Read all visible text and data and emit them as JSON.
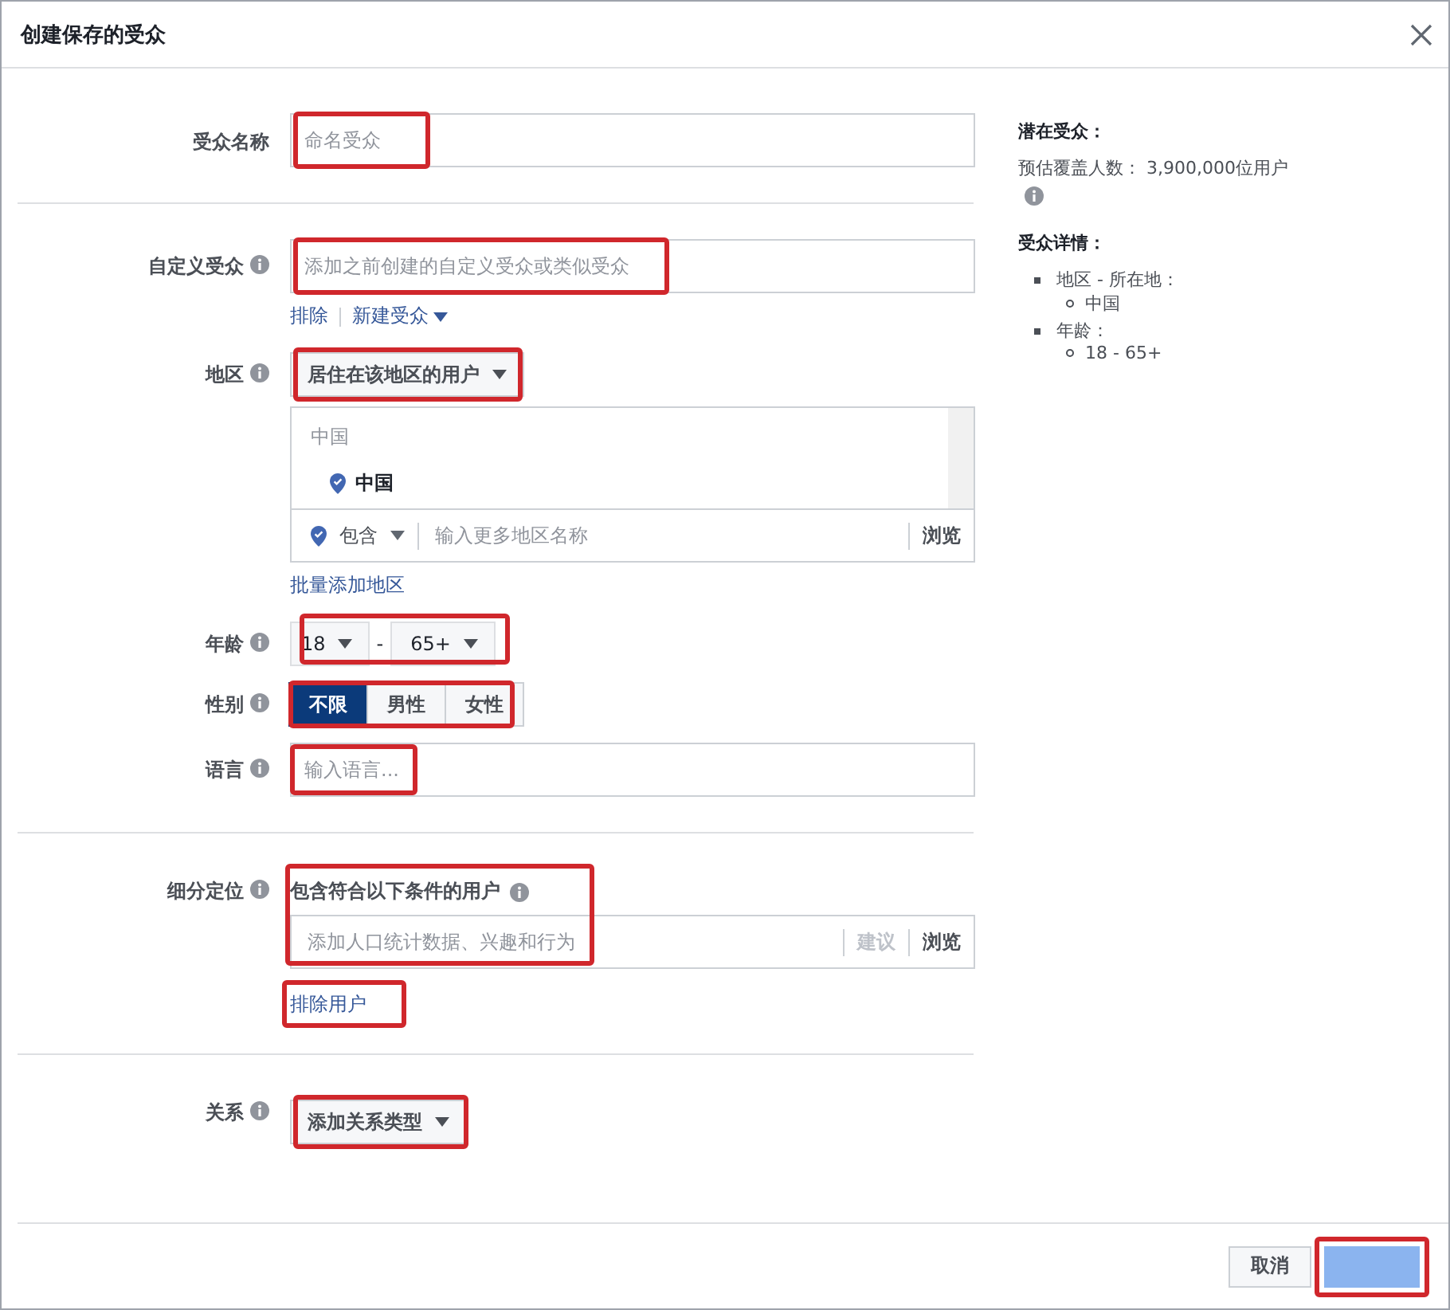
{
  "dialog": {
    "title": "创建保存的受众"
  },
  "audience_name": {
    "label": "受众名称",
    "placeholder": "命名受众",
    "highlighted": true
  },
  "custom_audience": {
    "label": "自定义受众",
    "placeholder": "添加之前创建的自定义受众或类似受众",
    "highlighted": true,
    "links": [
      {
        "label": "排除",
        "dropdown": false
      },
      {
        "label": "新建受众",
        "dropdown": true
      }
    ]
  },
  "location": {
    "label": "地区",
    "mode": "居住在该地区的用户",
    "highlighted": true,
    "group": "中国",
    "items": [
      {
        "label": "中国"
      }
    ],
    "include": "包含",
    "placeholder": "输入更多地区名称",
    "browse": "浏览",
    "bulk_link": "批量添加地区"
  },
  "age": {
    "label": "年龄",
    "min": "18",
    "separator": "-",
    "max": "65+",
    "highlighted": true
  },
  "gender": {
    "label": "性别",
    "highlighted": true,
    "options": [
      {
        "label": "不限",
        "selected": true
      },
      {
        "label": "男性",
        "selected": false
      },
      {
        "label": "女性",
        "selected": false
      }
    ]
  },
  "language": {
    "label": "语言",
    "placeholder": "输入语言...",
    "highlighted": true
  },
  "detailed_targeting": {
    "label": "细分定位",
    "heading": "包含符合以下条件的用户",
    "placeholder": "添加人口统计数据、兴趣和行为",
    "suggest": "建议",
    "browse": "浏览",
    "highlighted": true,
    "exclude_link": "排除用户",
    "exclude_highlighted": true
  },
  "connections": {
    "label": "关系",
    "dropdown": "添加关系类型",
    "highlighted": true
  },
  "summary": {
    "reach_heading": "潜在受众：",
    "reach": "预估覆盖人数： 3,900,000位用户",
    "details_heading": "受众详情：",
    "details": [
      {
        "label": "地区 - 所在地：",
        "children": [
          {
            "label": "中国"
          }
        ]
      },
      {
        "label": "年龄：",
        "children": [
          {
            "label": "18 - 65+"
          }
        ]
      }
    ]
  },
  "footer": {
    "buttons": [
      {
        "label": "取消",
        "kind": "secondary"
      },
      {
        "kind": "primary",
        "highlighted": true
      }
    ]
  }
}
